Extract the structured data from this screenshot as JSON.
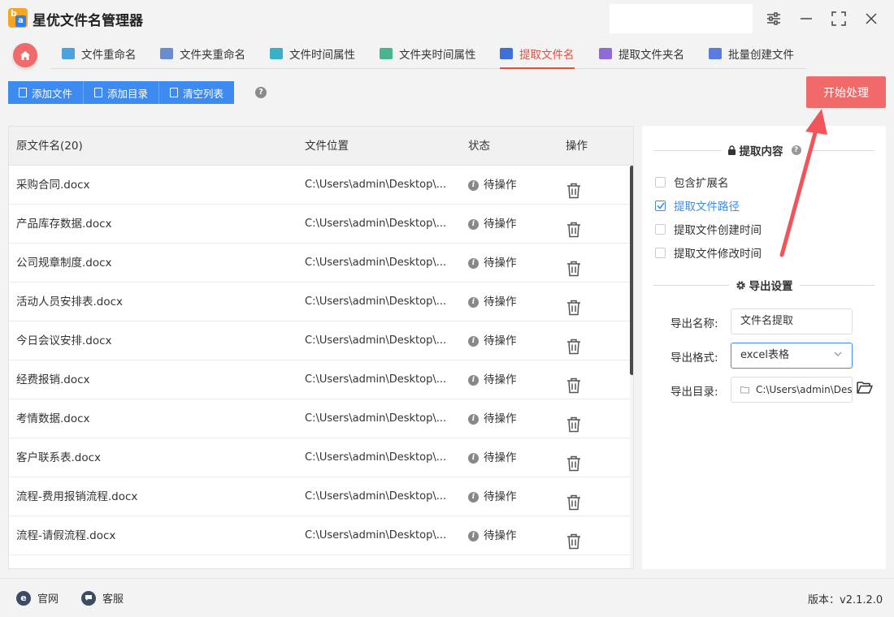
{
  "app": {
    "title": "星优文件名管理器",
    "logo_letter_top": "b",
    "logo_letter_bottom": "a"
  },
  "tabs": [
    {
      "label": "文件重命名",
      "icon": "file-rename-icon",
      "color": "#4aa3df"
    },
    {
      "label": "文件夹重命名",
      "icon": "folder-rename-icon",
      "color": "#6b8cce"
    },
    {
      "label": "文件时间属性",
      "icon": "file-time-icon",
      "color": "#3ab0c8"
    },
    {
      "label": "文件夹时间属性",
      "icon": "folder-time-icon",
      "color": "#48b58f"
    },
    {
      "label": "提取文件名",
      "icon": "extract-filename-icon",
      "color": "#3f6fd8",
      "active": true
    },
    {
      "label": "提取文件夹名",
      "icon": "extract-foldername-icon",
      "color": "#8e6bd6"
    },
    {
      "label": "批量创建文件",
      "icon": "batch-create-icon",
      "color": "#5a7be0"
    }
  ],
  "toolbar": {
    "add_file": "添加文件",
    "add_dir": "添加目录",
    "clear_list": "清空列表",
    "help": "?",
    "start": "开始处理"
  },
  "table": {
    "headers": {
      "name": "原文件名(20)",
      "location": "文件位置",
      "status": "状态",
      "op": "操作"
    },
    "rows": [
      {
        "name": "采购合同.docx",
        "location": "C:\\Users\\admin\\Desktop\\...",
        "status": "待操作"
      },
      {
        "name": "产品库存数据.docx",
        "location": "C:\\Users\\admin\\Desktop\\...",
        "status": "待操作"
      },
      {
        "name": "公司规章制度.docx",
        "location": "C:\\Users\\admin\\Desktop\\...",
        "status": "待操作"
      },
      {
        "name": "活动人员安排表.docx",
        "location": "C:\\Users\\admin\\Desktop\\...",
        "status": "待操作"
      },
      {
        "name": "今日会议安排.docx",
        "location": "C:\\Users\\admin\\Desktop\\...",
        "status": "待操作"
      },
      {
        "name": "经费报销.docx",
        "location": "C:\\Users\\admin\\Desktop\\...",
        "status": "待操作"
      },
      {
        "name": "考情数据.docx",
        "location": "C:\\Users\\admin\\Desktop\\...",
        "status": "待操作"
      },
      {
        "name": "客户联系表.docx",
        "location": "C:\\Users\\admin\\Desktop\\...",
        "status": "待操作"
      },
      {
        "name": "流程-费用报销流程.docx",
        "location": "C:\\Users\\admin\\Desktop\\...",
        "status": "待操作"
      },
      {
        "name": "流程-请假流程.docx",
        "location": "C:\\Users\\admin\\Desktop\\...",
        "status": "待操作"
      }
    ]
  },
  "panel": {
    "extract_title": "提取内容",
    "extract_help": "?",
    "options": [
      {
        "label": "包含扩展名",
        "checked": false
      },
      {
        "label": "提取文件路径",
        "checked": true
      },
      {
        "label": "提取文件创建时间",
        "checked": false
      },
      {
        "label": "提取文件修改时间",
        "checked": false
      }
    ],
    "export_title": "导出设置",
    "export_name_label": "导出名称:",
    "export_name_value": "文件名提取",
    "export_format_label": "导出格式:",
    "export_format_value": "excel表格",
    "export_dir_label": "导出目录:",
    "export_dir_value": "C:\\Users\\admin\\Desktop"
  },
  "footer": {
    "website": "官网",
    "support": "客服",
    "version": "版本：v2.1.2.0"
  },
  "colors": {
    "accent_red": "#f06a6a",
    "accent_blue": "#3d8bf0",
    "arrow": "#f2545b"
  }
}
